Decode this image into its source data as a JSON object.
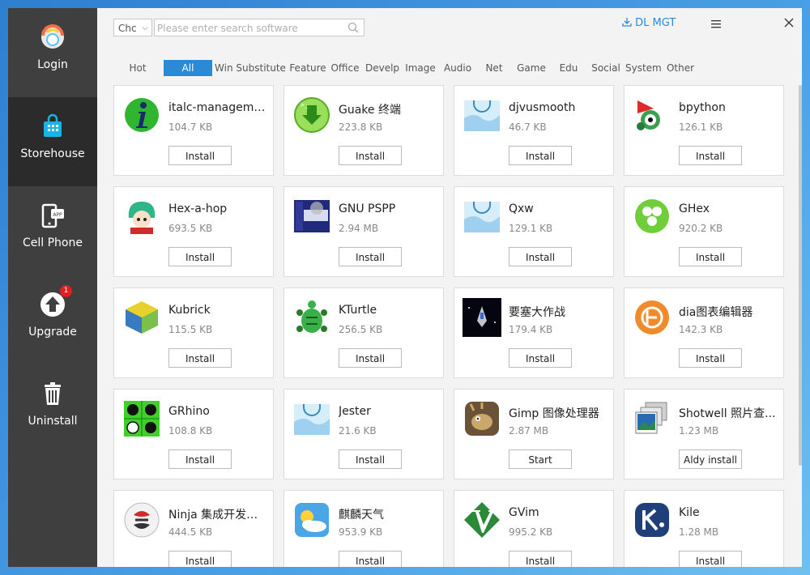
{
  "sidebar": {
    "items": [
      {
        "label": "Login",
        "icon": "login-icon"
      },
      {
        "label": "Storehouse",
        "icon": "store-bag-icon"
      },
      {
        "label": "Cell Phone",
        "icon": "cell-phone-app-icon"
      },
      {
        "label": "Upgrade",
        "icon": "upgrade-arrow-icon",
        "badge": "1"
      },
      {
        "label": "Uninstall",
        "icon": "trash-icon"
      }
    ]
  },
  "header": {
    "search_select": "Chc",
    "search_placeholder": "Please enter search software",
    "dl_mgt": "DL MGT"
  },
  "tabs": [
    "Hot",
    "All",
    "Win Substitute",
    "Feature",
    "Office",
    "Develp",
    "Image",
    "Audio",
    "Net",
    "Game",
    "Edu",
    "Social",
    "System",
    "Other"
  ],
  "active_tab": "All",
  "apps": [
    {
      "name": "italc-manageme...",
      "size": "104.7 KB",
      "action": "Install"
    },
    {
      "name": "Guake 终端",
      "size": "223.8 KB",
      "action": "Install"
    },
    {
      "name": "djvusmooth",
      "size": "46.7 KB",
      "action": "Install"
    },
    {
      "name": "bpython",
      "size": "126.1 KB",
      "action": "Install"
    },
    {
      "name": "Hex-a-hop",
      "size": "693.5 KB",
      "action": "Install"
    },
    {
      "name": "GNU PSPP",
      "size": "2.94 MB",
      "action": "Install"
    },
    {
      "name": "Qxw",
      "size": "129.1 KB",
      "action": "Install"
    },
    {
      "name": "GHex",
      "size": "920.2 KB",
      "action": "Install"
    },
    {
      "name": "Kubrick",
      "size": "115.5 KB",
      "action": "Install"
    },
    {
      "name": "KTurtle",
      "size": "256.5 KB",
      "action": "Install"
    },
    {
      "name": "要塞大作战",
      "size": "179.4 KB",
      "action": "Install"
    },
    {
      "name": "dia图表编辑器",
      "size": "142.3 KB",
      "action": "Install"
    },
    {
      "name": "GRhino",
      "size": "108.8 KB",
      "action": "Install"
    },
    {
      "name": "Jester",
      "size": "21.6 KB",
      "action": "Install"
    },
    {
      "name": "Gimp 图像处理器",
      "size": "2.87 MB",
      "action": "Start"
    },
    {
      "name": "Shotwell 照片查...",
      "size": "1.23 MB",
      "action": "Aldy install"
    },
    {
      "name": "Ninja 集成开发环境",
      "size": "444.5 KB",
      "action": "Install"
    },
    {
      "name": "麒麟天气",
      "size": "953.9 KB",
      "action": "Install"
    },
    {
      "name": "GVim",
      "size": "995.2 KB",
      "action": "Install"
    },
    {
      "name": "Kile",
      "size": "1.28 MB",
      "action": "Install"
    }
  ],
  "icons": {
    "apps": [
      "italc-info-icon",
      "guake-terminal-icon",
      "djvusmooth-icon",
      "bpython-snake-icon",
      "hex-a-hop-icon",
      "gnu-pspp-icon",
      "qxw-icon",
      "ghex-icon",
      "kubrick-cube-icon",
      "kturtle-icon",
      "fortress-game-icon",
      "dia-editor-icon",
      "grhino-board-icon",
      "jester-icon",
      "gimp-icon",
      "shotwell-icon",
      "ninja-ide-icon",
      "kylin-weather-icon",
      "gvim-icon",
      "kile-icon"
    ]
  },
  "colors": {
    "accent": "#2b8ad8",
    "sidebar": "#3f3f3f",
    "sidebar_active": "#2b2b2b",
    "badge": "#e02020"
  }
}
